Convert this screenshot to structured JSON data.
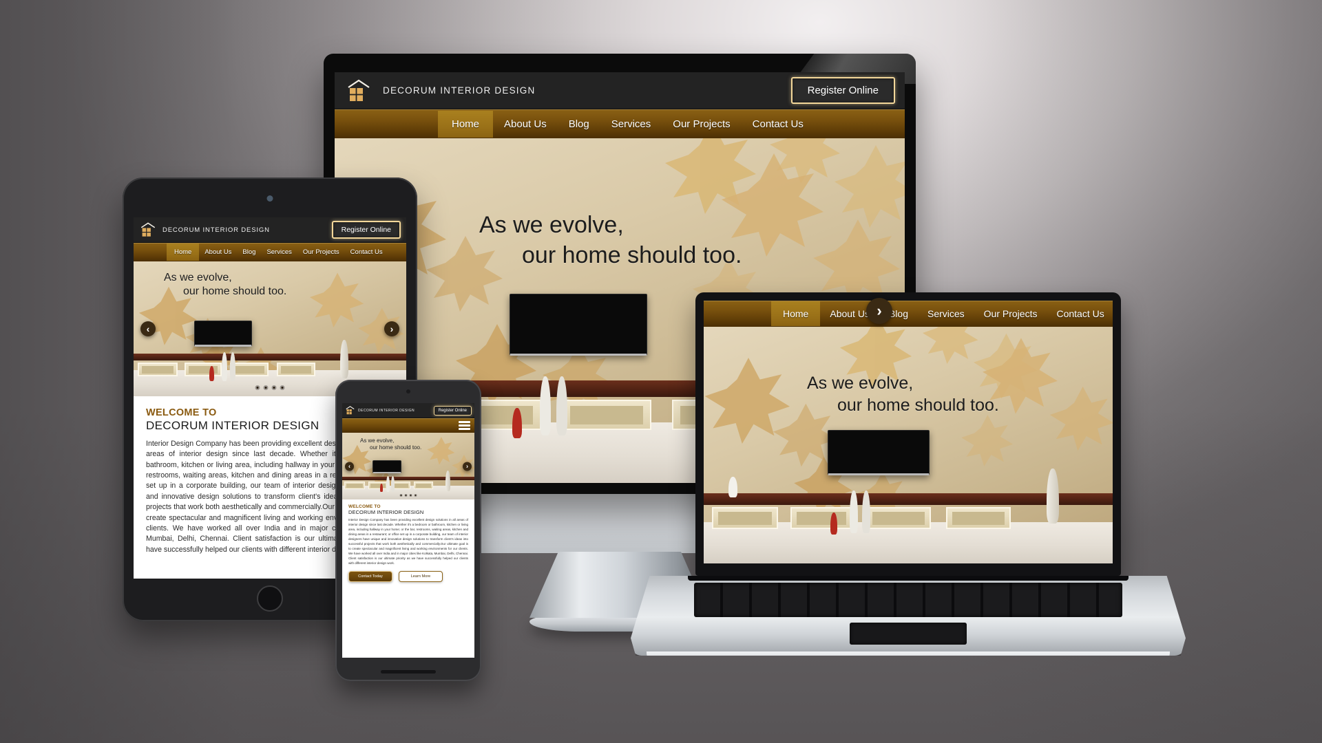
{
  "site": {
    "brand": "DECORUM INTERIOR DESIGN",
    "register_label": "Register Online",
    "logo_icon": "house-window-icon",
    "nav": [
      {
        "label": "Home",
        "active": true
      },
      {
        "label": "About Us",
        "active": false
      },
      {
        "label": "Blog",
        "active": false
      },
      {
        "label": "Services",
        "active": false
      },
      {
        "label": "Our Projects",
        "active": false
      },
      {
        "label": "Contact Us",
        "active": false
      }
    ],
    "hero": {
      "tagline_line1": "As we evolve,",
      "tagline_line2": "our home should too.",
      "prev_icon": "chevron-left-icon",
      "next_icon": "chevron-right-icon",
      "prev_glyph": "‹",
      "next_glyph": "›",
      "slide_count": 4,
      "active_slide": 1
    },
    "welcome": {
      "eyebrow": "WELCOME TO",
      "heading": "DECORUM INTERIOR DESIGN",
      "paragraph": "Interior Design Company has been providing excellent design solutions in all areas of interior design since last decade. Whether it's a bedroom or bathroom, kitchen or living area, including hallway in your home; or the bar, restrooms, waiting areas, kitchen and dining areas in a restaurant; or office set up in a corporate building, our team of interior designers have unique and innovative design solutions to transform client's ideas into successful projects that work both aesthetically and commercially.Our ultimate goal is to create spectacular and magnificent living and working environments for our clients. We have worked all over India and in major cities like Kolkata, Mumbai, Delhi, Chennai. Client satisfaction is our ultimate priority as we have successfully helped our clients with different interior design work."
    },
    "cta": {
      "primary": "Contact Today",
      "secondary": "Learn More"
    },
    "menu_icon": "hamburger-menu-icon"
  },
  "devices": [
    {
      "name": "desktop-monitor"
    },
    {
      "name": "tablet"
    },
    {
      "name": "smartphone"
    },
    {
      "name": "laptop"
    }
  ],
  "colors": {
    "nav_gold": "#7a520e",
    "nav_gold_active": "#9a7118",
    "header_dark": "#232323",
    "accent_cream": "#f3d79a",
    "heading_brown": "#8a5a10",
    "backdrop": "#9b9698"
  }
}
